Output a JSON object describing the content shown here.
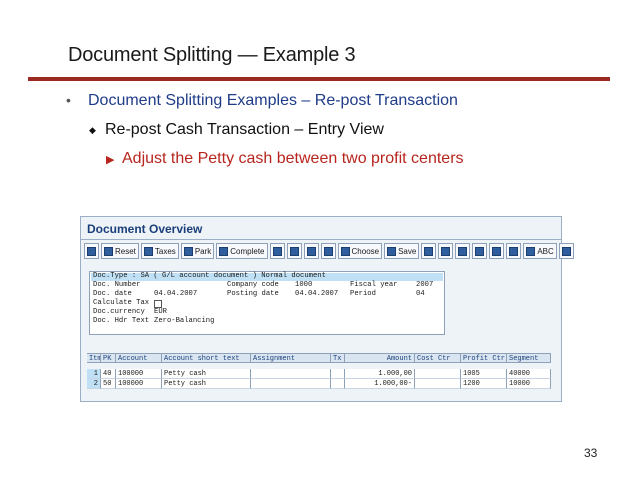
{
  "slide": {
    "title": "Document Splitting — Example 3",
    "bullet1": "Document Splitting Examples – Re-post Transaction",
    "bullet2": "Re-post Cash Transaction – Entry View",
    "bullet3": "Adjust the Petty cash between two profit centers",
    "page_number": "33"
  },
  "sap": {
    "title": "Document Overview",
    "toolbar": {
      "reset": "Reset",
      "taxes": "Taxes",
      "park": "Park",
      "complete": "Complete",
      "choose": "Choose",
      "save": "Save",
      "abc": "ABC"
    },
    "header": {
      "doc_type_line": "Doc.Type : SA ( G/L account document ) Normal document",
      "doc_number_label": "Doc. Number",
      "company_code_label": "Company code",
      "company_code": "1000",
      "fiscal_year_label": "Fiscal year",
      "fiscal_year": "2007",
      "doc_date_label": "Doc. date",
      "doc_date": "04.04.2007",
      "posting_date_label": "Posting date",
      "posting_date": "04.04.2007",
      "period_label": "Period",
      "period": "04",
      "calculate_tax_label": "Calculate Tax",
      "doc_currency_label": "Doc.currency",
      "doc_currency": "EUR",
      "doc_hdr_text_label": "Doc. Hdr Text",
      "doc_hdr_text": "Zero-Balancing"
    },
    "table": {
      "columns": [
        "Itm",
        "PK",
        "Account",
        "Account short text",
        "Assignment",
        "Tx",
        "Amount",
        "Cost Ctr",
        "Profit Ctr",
        "Segment"
      ],
      "rows": [
        [
          "1",
          "40",
          "100000",
          "Petty cash",
          "",
          "",
          "1.000,00",
          "",
          "1005",
          "40000"
        ],
        [
          "2",
          "50",
          "100000",
          "Petty cash",
          "",
          "",
          "1.000,00-",
          "",
          "1200",
          "10000"
        ]
      ]
    }
  }
}
